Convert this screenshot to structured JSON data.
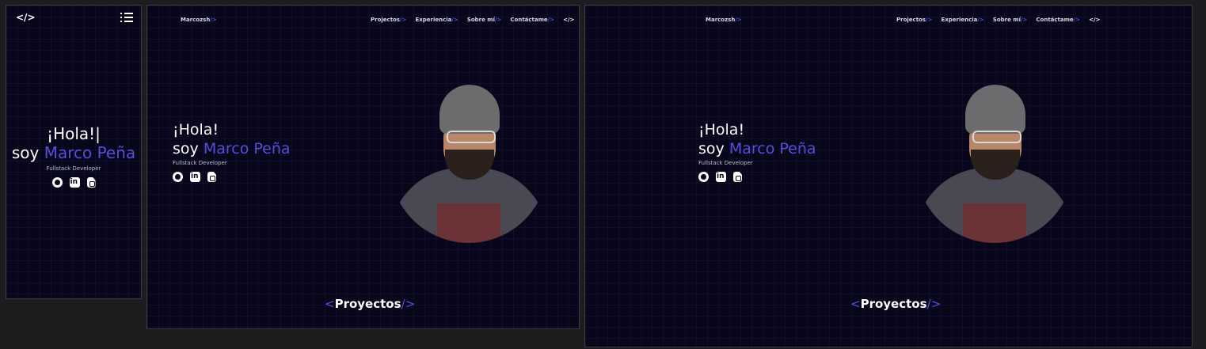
{
  "logo_text": "</>",
  "hero": {
    "greeting": "¡Hola!",
    "greeting_mobile": "¡Hola!|",
    "intro": "soy",
    "name": "Marco Peña",
    "role": "Fullstack Developer"
  },
  "nav": {
    "brand": "Marcozsh",
    "items": [
      {
        "label": "Projectos"
      },
      {
        "label": "Experiencia"
      },
      {
        "label": "Sobre mí"
      },
      {
        "label": "Contáctame"
      }
    ],
    "code_icon_text": "</>"
  },
  "section": {
    "open": "<",
    "title": "Proyectos",
    "close": "/>"
  },
  "socials": [
    "github-icon",
    "linkedin-icon",
    "pdf-icon"
  ],
  "colors": {
    "background": "#07061a",
    "accent": "#5b4bdc",
    "text": "#ffffff"
  }
}
